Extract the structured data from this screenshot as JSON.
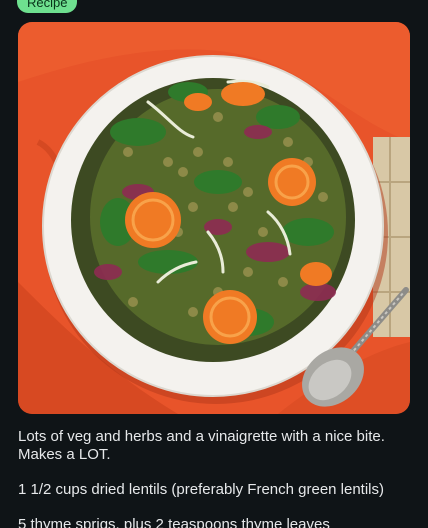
{
  "badge": {
    "label": "Recipe"
  },
  "photo": {
    "icon": "salad-bowl-photo"
  },
  "post": {
    "intro": "Lots of veg and herbs and a vinaigrette with a nice bite. Makes a LOT.",
    "ingredient_1": "1 1/2 cups dried lentils (preferably French green lentils)",
    "ingredient_2": "5 thyme sprigs, plus 2 teaspoons thyme leaves"
  },
  "colors": {
    "background": "#0f1417",
    "badge": "#6ee08f",
    "cloth": "#e8542a",
    "bowl": "#f4f2ee",
    "text": "#e6e8ea"
  }
}
